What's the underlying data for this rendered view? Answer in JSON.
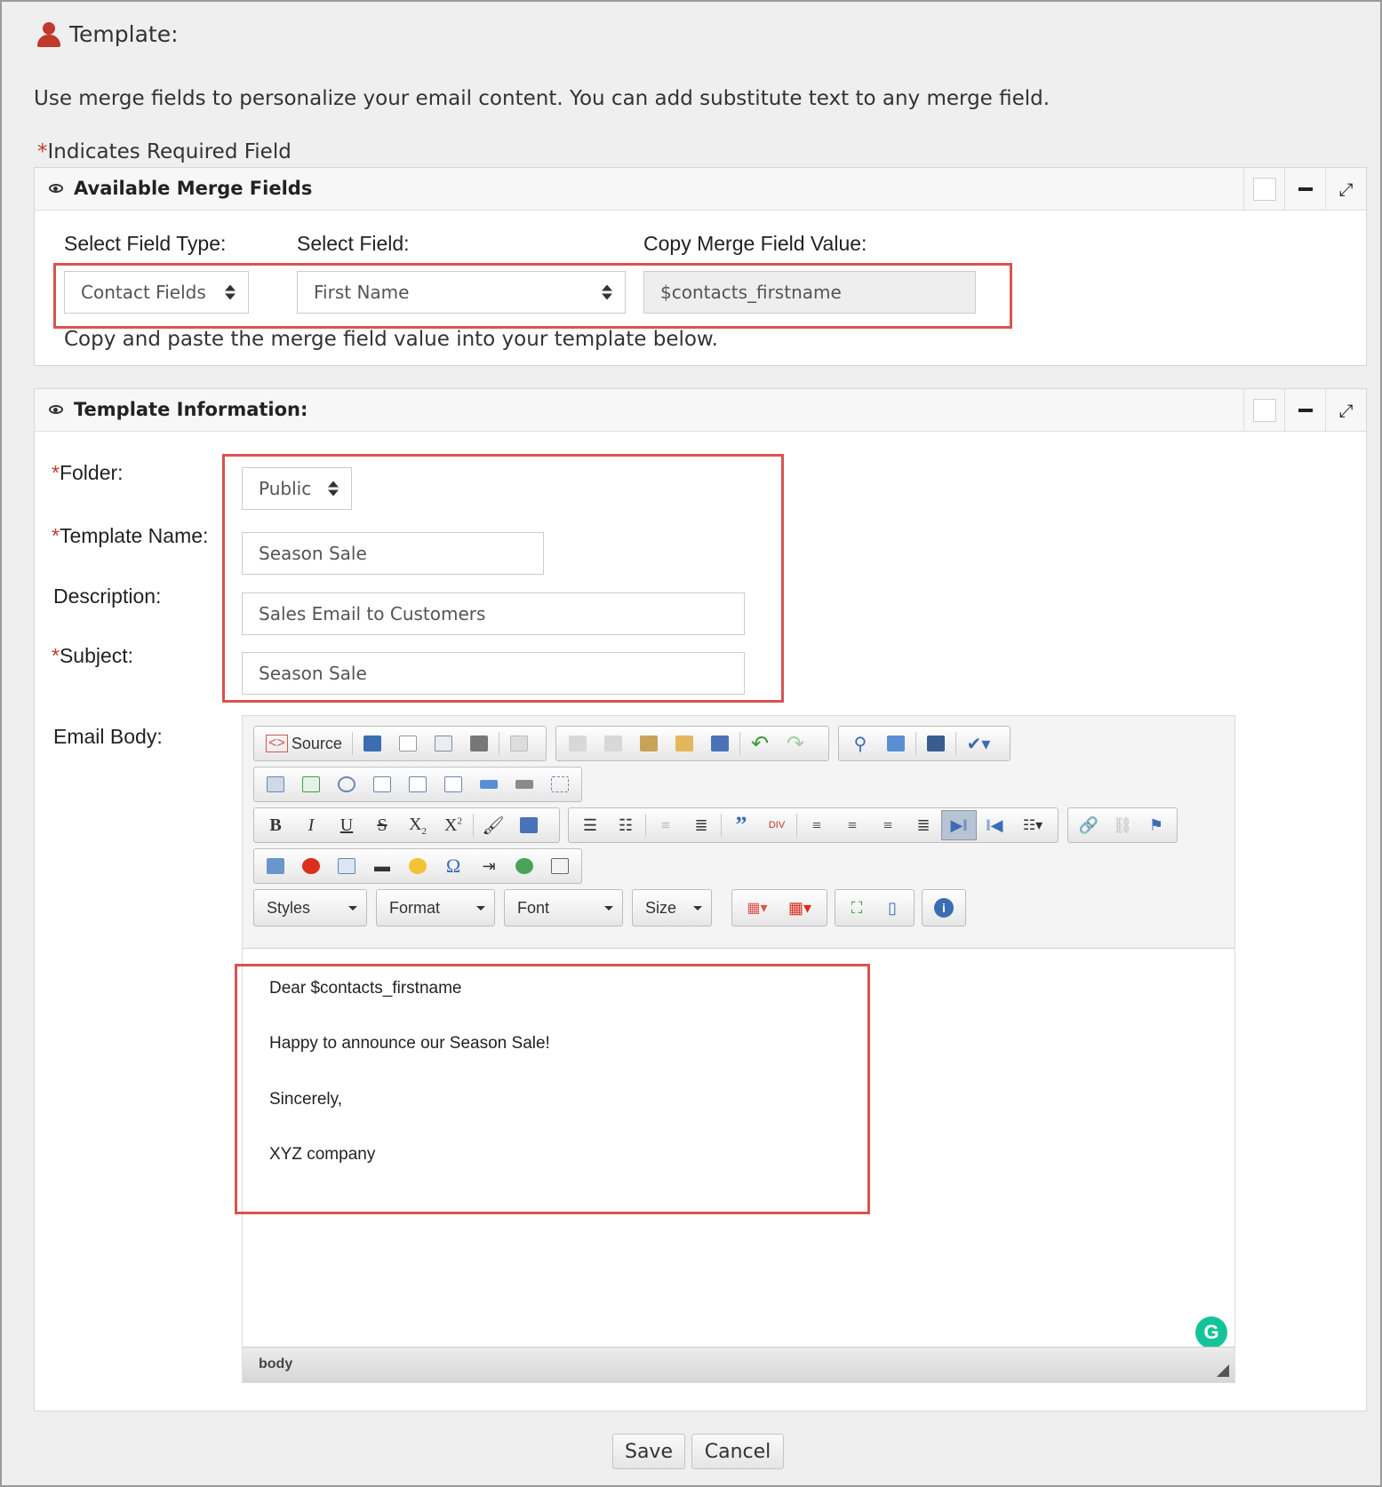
{
  "header": {
    "title": "Template:"
  },
  "intro": "Use merge fields to personalize your email content. You can add substitute text to any merge field.",
  "required_note": {
    "star": "*",
    "text": "Indicates Required Field"
  },
  "merge_panel": {
    "title": "Available Merge Fields",
    "field_type_label": "Select Field Type:",
    "field_label": "Select Field:",
    "copy_label": "Copy Merge Field Value:",
    "field_type_value": "Contact Fields",
    "field_value": "First Name",
    "merge_value": "$contacts_firstname",
    "hint": "Copy and paste the merge field value into your template below."
  },
  "template_panel": {
    "title": "Template Information:",
    "folder_label": "Folder:",
    "name_label": "Template Name:",
    "description_label": "Description:",
    "subject_label": "Subject:",
    "body_label": "Email Body:",
    "folder_value": "Public",
    "name_value": "Season Sale",
    "description_value": "Sales Email to Customers",
    "subject_value": "Season Sale"
  },
  "editor": {
    "source_label": "Source",
    "combos": {
      "styles": "Styles",
      "format": "Format",
      "font": "Font",
      "size": "Size"
    },
    "body_lines": [
      "Dear $contacts_firstname",
      "Happy to announce our Season Sale!",
      "Sincerely,",
      "XYZ company"
    ],
    "status_path": "body",
    "grammarly_glyph": "G"
  },
  "buttons": {
    "save": "Save",
    "cancel": "Cancel"
  },
  "colors": {
    "required": "#c0392b",
    "highlight": "#d9534f",
    "grammarly": "#15c39a"
  }
}
